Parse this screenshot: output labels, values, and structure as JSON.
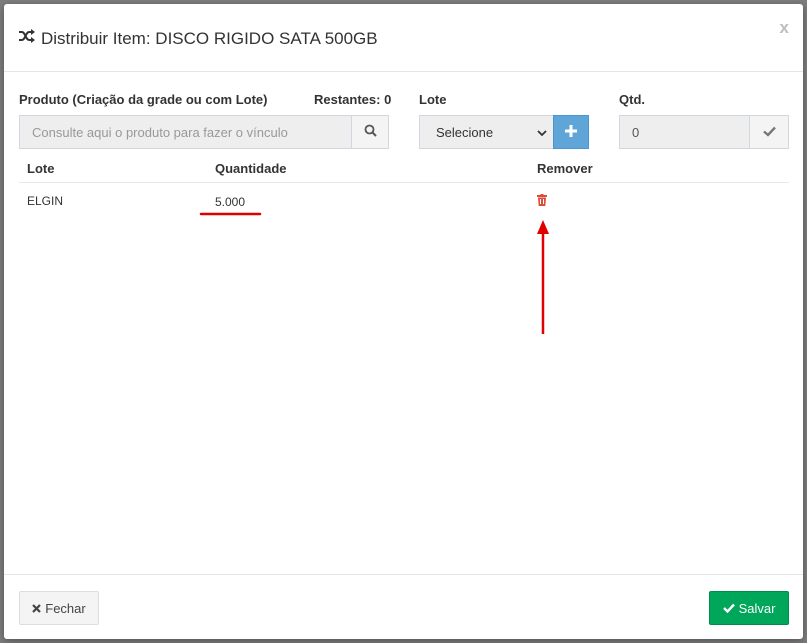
{
  "modal": {
    "title": "Distribuir Item: DISCO RIGIDO SATA 500GB",
    "close_label": "x"
  },
  "form": {
    "produto_label": "Produto (Criação da grade ou com Lote)",
    "restantes_label": "Restantes: 0",
    "produto_placeholder": "Consulte aqui o produto para fazer o vínculo",
    "lote_label": "Lote",
    "lote_selected": "Selecione",
    "qtd_label": "Qtd.",
    "qtd_value": "0"
  },
  "table": {
    "headers": [
      "Lote",
      "Quantidade",
      "Remover"
    ],
    "rows": [
      {
        "lote": "ELGIN",
        "quantidade": "5.000"
      }
    ]
  },
  "footer": {
    "fechar_label": "Fechar",
    "salvar_label": "Salvar"
  },
  "colors": {
    "plus_button": "#60a5d8",
    "salvar_button": "#00a65a",
    "trash_icon": "#dd4b39",
    "annotation": "#e00000"
  },
  "icons": {
    "title": "shuffle-icon",
    "search": "search-icon",
    "add": "plus-icon",
    "confirm": "check-icon",
    "remove": "trash-icon",
    "fechar": "close-icon",
    "salvar": "check-icon"
  }
}
